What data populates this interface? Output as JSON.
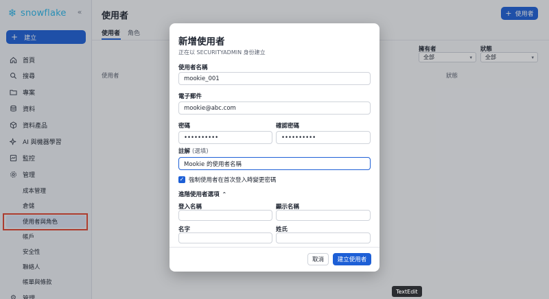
{
  "sidebar": {
    "logo_text": "snowflake",
    "create_label": "建立",
    "nav": [
      {
        "label": "首頁",
        "icon": "home-icon"
      },
      {
        "label": "搜尋",
        "icon": "search-icon"
      },
      {
        "label": "專案",
        "icon": "folder-icon"
      },
      {
        "label": "資料",
        "icon": "database-icon"
      },
      {
        "label": "資料產品",
        "icon": "cube-icon"
      },
      {
        "label": "AI 與機器學習",
        "icon": "sparkle-icon"
      },
      {
        "label": "監控",
        "icon": "monitor-icon"
      },
      {
        "label": "管理",
        "icon": "gear-icon"
      }
    ],
    "sub_items": [
      "成本管理",
      "倉儲",
      "使用者與角色",
      "帳戶",
      "安全性",
      "聯絡人",
      "帳單與條款"
    ],
    "bottom_partial": "管理"
  },
  "main": {
    "title": "使用者",
    "tabs": [
      "使用者",
      "角色"
    ],
    "add_user_label": "使用者",
    "filters": [
      {
        "label": "擁有者",
        "value": "全部"
      },
      {
        "label": "狀態",
        "value": "全部"
      }
    ],
    "column_headers": [
      "使用者",
      "狀態"
    ]
  },
  "modal": {
    "title": "新增使用者",
    "subtitle": "正在以 SECURITYADMIN 身份建立",
    "username_label": "使用者名稱",
    "username_value": "mookie_001",
    "email_label": "電子郵件",
    "email_value": "mookie@abc.com",
    "password_label": "密碼",
    "password_value": "••••••••••",
    "confirm_label": "確認密碼",
    "confirm_value": "••••••••••",
    "comment_label": "註解",
    "comment_optional": "(選填)",
    "comment_value": "Mookie 的使用者名稱",
    "force_change_label": "強制使用者在首次登入時變更密碼",
    "advanced_label": "進階使用者選項",
    "login_name_label": "登入名稱",
    "display_name_label": "顯示名稱",
    "first_name_label": "名字",
    "last_name_label": "姓氏",
    "cancel_label": "取消",
    "submit_label": "建立使用者"
  },
  "tooltip": "TextEdit",
  "colors": {
    "accent": "#1d5fd6",
    "brand": "#29b5e8",
    "highlight": "#e0432f"
  }
}
